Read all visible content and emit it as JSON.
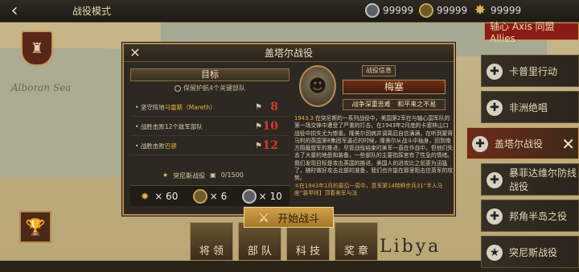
{
  "topbar": {
    "title": "战役模式",
    "resources": [
      {
        "icon": "silver-coin-icon",
        "value": "99999"
      },
      {
        "icon": "gold-coin-icon",
        "value": "99999"
      },
      {
        "icon": "star-medal-icon",
        "value": "99999"
      }
    ]
  },
  "map": {
    "labels": [
      "Alboran Sea",
      "Libya"
    ]
  },
  "faction_tab": "轴心 Axis 同盟 Allies",
  "side_list": [
    {
      "label": "卡普里行动",
      "icon": "cross-icon",
      "active": false
    },
    {
      "label": "非洲绝唱",
      "icon": "cross-icon",
      "active": false
    },
    {
      "label": "盖塔尔战役",
      "icon": "cross-icon",
      "active": true
    },
    {
      "label": "暴菲达维尔防线战役",
      "icon": "cross-icon",
      "active": false
    },
    {
      "label": "邦角半岛之役",
      "icon": "cross-icon",
      "active": false
    },
    {
      "label": "突尼斯战役",
      "icon": "star-icon",
      "active": false
    }
  ],
  "bottom_tabs": [
    "将 领",
    "部 队",
    "科 技",
    "奖 章"
  ],
  "dialog": {
    "title": "盖塔尔战役",
    "goal_title": "目标",
    "goal_sub": "保留护航4个关键部队",
    "objectives": [
      {
        "text_pre": "坚守阵地",
        "highlight": "马雷斯（Mareth）",
        "text_post": "",
        "turns": "8"
      },
      {
        "text_pre": "战胜击败12个敌军部队",
        "highlight": "",
        "text_post": "",
        "turns": "10"
      },
      {
        "text_pre": "战胜击败",
        "highlight": "巴顿",
        "text_post": "",
        "turns": "12"
      }
    ],
    "progress_label": "突尼斯战役",
    "progress_value": "0/1500",
    "rewards": [
      {
        "icon": "star-medal-icon",
        "value": "× 60"
      },
      {
        "icon": "gold-coin-icon",
        "value": "× 6"
      },
      {
        "icon": "silver-coin-icon",
        "value": "× 10"
      }
    ],
    "info_button": "战役信息",
    "general_name": "梅塞",
    "traits": "战争深重苦难 和平来之不易",
    "desc_year": "1943.3",
    "desc_body": "在突尼斯的一系列战役中，美国第2军在与轴心国军队的第一场交锋中遭受了严重的打击，在1943年2月底的卡塞林山口战役中损失尤为惨重。隆美尔因病并调离后自信满满，在听到蒙哥马利的英国第8集团军逼近的时候，隆美尔从战斗中抽身，回到南方阻截盟军的推进。尽管战役结束时美军一直在作战中，但他们失去了大量的地盘和装备，一些部队的主要指挥官有了性急的情绪。",
    "desc_body2": "我们发现目标是攻击英国的推进，美国人的进攻比之前更为迅猛了，随时做好攻击北部的准备，我们也许能在那里阻击住英军的攻势。",
    "desc_note": "①在1943年1月的最后一周中，意军第14特种步兵31“半人马座”装甲师】顶着美军与法",
    "start_label": "开始战斗"
  }
}
